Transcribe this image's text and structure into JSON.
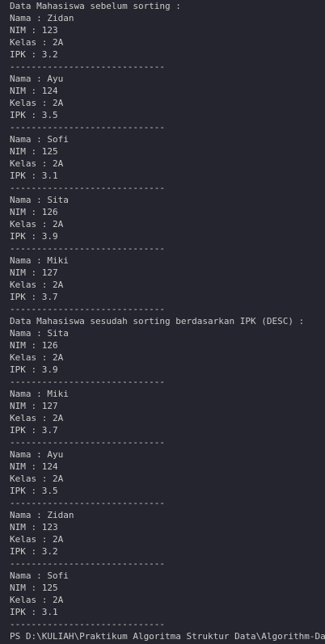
{
  "before": {
    "header": "Data Mahasiswa sebelum sorting :",
    "records": [
      {
        "nama": "Nama : Zidan",
        "nim": "NIM : 123",
        "kelas": "Kelas : 2A",
        "ipk": "IPK : 3.2",
        "divider": "-----------------------------"
      },
      {
        "nama": "Nama : Ayu",
        "nim": "NIM : 124",
        "kelas": "Kelas : 2A",
        "ipk": "IPK : 3.5",
        "divider": "-----------------------------"
      },
      {
        "nama": "Nama : Sofi",
        "nim": "NIM : 125",
        "kelas": "Kelas : 2A",
        "ipk": "IPK : 3.1",
        "divider": "-----------------------------"
      },
      {
        "nama": "Nama : Sita",
        "nim": "NIM : 126",
        "kelas": "Kelas : 2A",
        "ipk": "IPK : 3.9",
        "divider": "-----------------------------"
      },
      {
        "nama": "Nama : Miki",
        "nim": "NIM : 127",
        "kelas": "Kelas : 2A",
        "ipk": "IPK : 3.7",
        "divider": "-----------------------------"
      }
    ]
  },
  "after": {
    "header": "Data Mahasiswa sesudah sorting berdasarkan IPK (DESC) :",
    "records": [
      {
        "nama": "Nama : Sita",
        "nim": "NIM : 126",
        "kelas": "Kelas : 2A",
        "ipk": "IPK : 3.9",
        "divider": "-----------------------------"
      },
      {
        "nama": "Nama : Miki",
        "nim": "NIM : 127",
        "kelas": "Kelas : 2A",
        "ipk": "IPK : 3.7",
        "divider": "-----------------------------"
      },
      {
        "nama": "Nama : Ayu",
        "nim": "NIM : 124",
        "kelas": "Kelas : 2A",
        "ipk": "IPK : 3.5",
        "divider": "-----------------------------"
      },
      {
        "nama": "Nama : Zidan",
        "nim": "NIM : 123",
        "kelas": "Kelas : 2A",
        "ipk": "IPK : 3.2",
        "divider": "-----------------------------"
      },
      {
        "nama": "Nama : Sofi",
        "nim": "NIM : 125",
        "kelas": "Kelas : 2A",
        "ipk": "IPK : 3.1",
        "divider": "-----------------------------"
      }
    ]
  },
  "prompt": "PS D:\\KULIAH\\Praktikum Algoritma Struktur Data\\Algorithm-Data-Str"
}
